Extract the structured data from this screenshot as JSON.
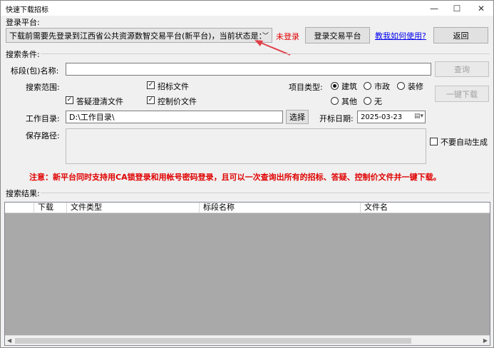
{
  "window": {
    "title": "快速下载招标",
    "minimize": "—",
    "maximize": "☐",
    "close": "✕"
  },
  "login": {
    "group_label": "登录平台:",
    "platform_value": "下载前需要先登录到江西省公共资源数智交易平台(新平台)，当前状态是：",
    "status": "未登录",
    "login_button": "登录交易平台",
    "help_link": "教我如何使用?",
    "back_button": "返回"
  },
  "search": {
    "group_label": "搜索条件:",
    "name_label": "标段(包)名称:",
    "name_value": "",
    "query_button": "查询",
    "scope_label": "搜索范围:",
    "scope_options": [
      {
        "label": "招标文件",
        "checked": true
      },
      {
        "label": "答疑澄清文件",
        "checked": true
      },
      {
        "label": "控制价文件",
        "checked": true
      }
    ],
    "type_label": "项目类型:",
    "type_options": [
      {
        "label": "建筑",
        "selected": true
      },
      {
        "label": "市政",
        "selected": false
      },
      {
        "label": "装修",
        "selected": false
      },
      {
        "label": "其他",
        "selected": false
      },
      {
        "label": "无",
        "selected": false
      }
    ],
    "download_button": "一键下载",
    "workdir_label": "工作目录:",
    "workdir_value": "D:\\工作目录\\",
    "select_button": "选择",
    "date_label": "开标日期:",
    "date_value": "2025-03-23",
    "save_label": "保存路径:",
    "save_value": "",
    "auto_gen_label": "不要自动生成",
    "auto_gen_checked": false
  },
  "note": "注意：新平台同时支持用CA锁登录和用帐号密码登录，且可以一次查询出所有的招标、答疑、控制价文件并一键下载。",
  "results": {
    "group_label": "搜索结果:",
    "columns": [
      "下载",
      "文件类型",
      "标段名称",
      "文件名"
    ],
    "rows": []
  },
  "colors": {
    "status_red": "#e00000",
    "link_blue": "#0000ee",
    "note_red": "#e00000",
    "arrow_red": "#e0404a",
    "grid_bg": "#a9a9a9"
  }
}
